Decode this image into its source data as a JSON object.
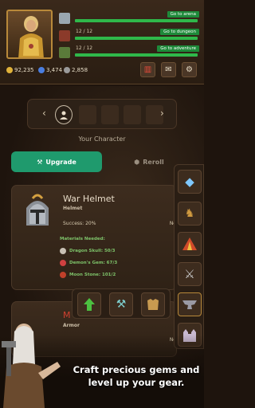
{
  "quests": [
    {
      "label": "",
      "button": "Go to arena",
      "fill": 1.0,
      "icon_color": "#9aa7b0"
    },
    {
      "label": "12 / 12",
      "button": "Go to dungeon",
      "fill": 1.0,
      "icon_color": "#8b3a2a"
    },
    {
      "label": "12 / 12",
      "button": "Go to adventure",
      "fill": 1.0,
      "icon_color": "#5a7a3a"
    }
  ],
  "resources": {
    "gold": "92,235",
    "gems": "3,474",
    "silver": "2,858"
  },
  "character": {
    "label": "Your Character"
  },
  "tabs": {
    "upgrade": "Upgrade",
    "reroll": "Reroll"
  },
  "item1": {
    "name": "War Helmet",
    "type": "Helmet",
    "success": "Success: 20%",
    "needed_cut": "Ne",
    "materials_title": "Materials Needed:",
    "materials": [
      "Dragon Skull: 50/3",
      "Demon's Gem: 67/3",
      "Moon Stone: 101/2"
    ]
  },
  "item2": {
    "name": "M",
    "type": "Armor",
    "needed_cut": "Ne"
  },
  "promo": {
    "line1": "Craft precious gems and",
    "line2": "level up your gear."
  },
  "colors": {
    "accent_green": "#1f9a6d",
    "bar_green": "#2fb84a",
    "button_green": "#1e8a3a"
  }
}
